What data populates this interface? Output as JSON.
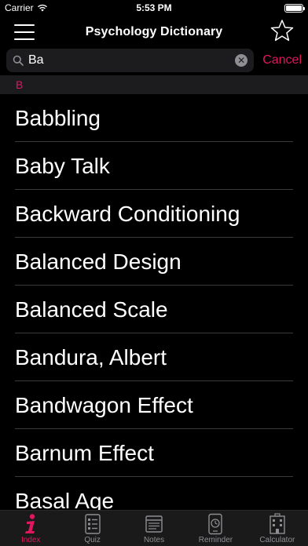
{
  "status": {
    "carrier": "Carrier",
    "time": "5:53 PM",
    "battery_level": 1.0
  },
  "nav": {
    "title": "Psychology Dictionary",
    "menu_icon": "hamburger-menu-icon",
    "favorite_icon": "star-icon"
  },
  "search": {
    "value": "Ba",
    "placeholder": "Search",
    "cancel_label": "Cancel"
  },
  "section": {
    "header": "B"
  },
  "terms": [
    "Babbling",
    "Baby Talk",
    "Backward Conditioning",
    "Balanced Design",
    "Balanced Scale",
    "Bandura, Albert",
    "Bandwagon Effect",
    "Barnum Effect",
    "Basal Age"
  ],
  "tabs": [
    {
      "label": "Index",
      "icon": "info-icon",
      "active": true
    },
    {
      "label": "Quiz",
      "icon": "quiz-icon",
      "active": false
    },
    {
      "label": "Notes",
      "icon": "notes-icon",
      "active": false
    },
    {
      "label": "Reminder",
      "icon": "reminder-icon",
      "active": false
    },
    {
      "label": "Calculator",
      "icon": "calculator-icon",
      "active": false
    }
  ],
  "colors": {
    "accent": "#e0165f",
    "background": "#000000",
    "surface": "#1c1c1e"
  }
}
